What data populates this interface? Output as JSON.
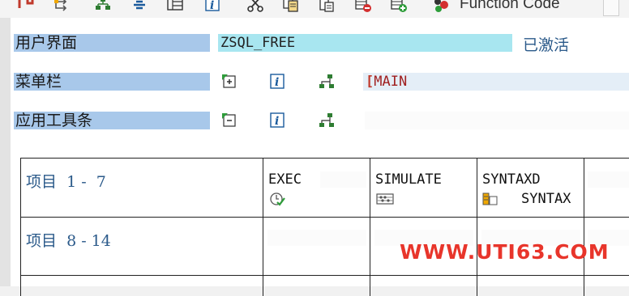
{
  "toolbar": {
    "function_code_label": "Function Code",
    "icons": [
      "arrow-left-icon",
      "branch-icon",
      "hierarchy-icon",
      "align-center-icon",
      "layout-icon",
      "info-icon",
      "scissors-icon",
      "copy-icon",
      "paste-icon",
      "delete-row-icon",
      "add-row-icon",
      "function-code-icon",
      "blank-page-icon"
    ]
  },
  "form": {
    "ui_label": "用户界面",
    "ui_value": "ZSQL_FREE",
    "ui_status": "已激活",
    "menu_label": "菜单栏",
    "menu_value": "MAIN",
    "toolbar_label": "应用工具条",
    "toolbar_value": ""
  },
  "grid": {
    "rows": [
      {
        "label": "项目  1 -  7",
        "cells": [
          {
            "code": "EXEC",
            "sub": "",
            "icon": "clock-check-icon"
          },
          {
            "code": "SIMULATE",
            "sub": "",
            "icon": "abacus-icon"
          },
          {
            "code": "SYNTAXD",
            "sub": "SYNTAX",
            "icon": "syntax-icon"
          }
        ]
      },
      {
        "label": "项目  8 - 14",
        "cells": []
      }
    ]
  },
  "watermark": "WWW.UTI63.COM",
  "colors": {
    "label_bg": "#a8c8ea",
    "field_active_bg": "#a8e6f0",
    "status_text": "#2b5a8a",
    "watermark": "#e8352b"
  }
}
